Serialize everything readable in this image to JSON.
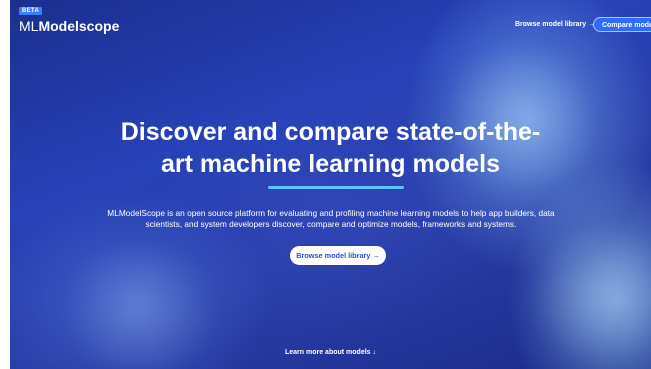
{
  "header": {
    "badge": "BETA",
    "logo_light": "ML",
    "logo_bold": "Modelscope",
    "nav_link": "Browse model library →",
    "nav_button": "Compare models ∨"
  },
  "hero": {
    "title_line1": "Discover and compare state-of-the-",
    "title_line2": "art machine learning models",
    "description": "MLModelScope is an open source platform for evaluating and profiling machine learning models to help app builders, data scientists, and system developers discover, compare and optimize models, frameworks and systems.",
    "cta": "Browse model library →",
    "learn_more": "Learn more about models ↓"
  },
  "colors": {
    "accent": "#2d6cff",
    "divider": "#5fc3ff",
    "background": "#2741b8"
  }
}
